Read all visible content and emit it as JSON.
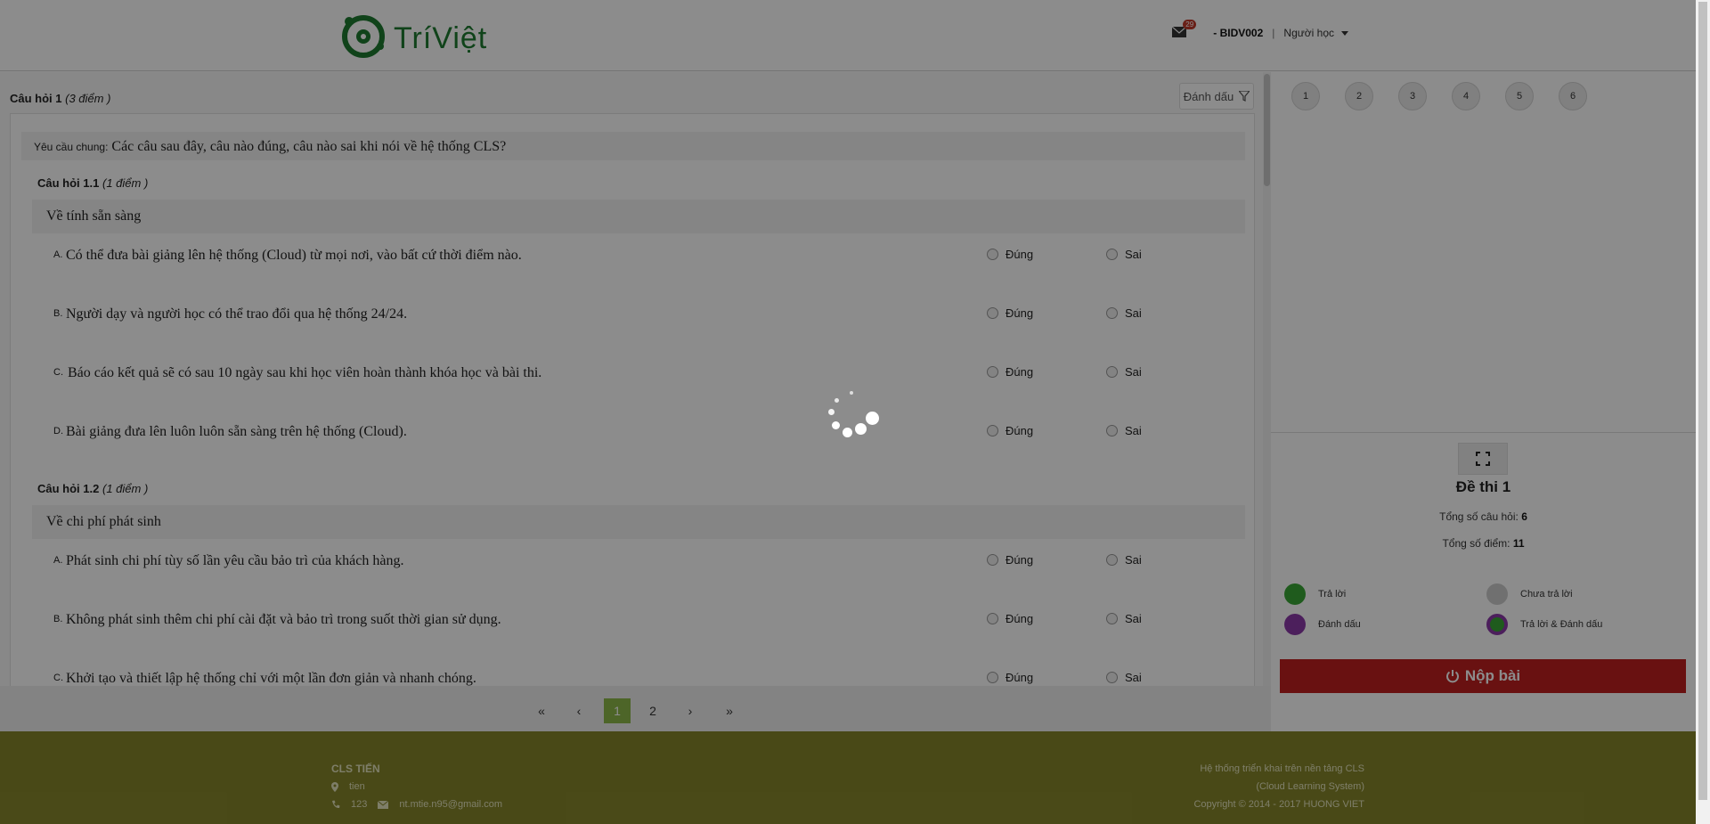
{
  "header": {
    "logo_text": "TríViệt",
    "mail_count": "29",
    "user_code": "- BIDV002",
    "separator": "|",
    "role": "Người học"
  },
  "question": {
    "title": "Câu hỏi 1",
    "points": "(3 điểm )",
    "mark_label": "Đánh dấu",
    "requirement_label": "Yêu cầu chung:",
    "requirement_text": "Các câu sau đây, câu nào đúng, câu nào sai khi nói về hệ thống CLS?",
    "true_label": "Đúng",
    "false_label": "Sai",
    "subquestions": [
      {
        "title": "Câu hỏi 1.1",
        "points": "(1 điểm )",
        "topic": "Về tính sẵn sàng",
        "answers": [
          {
            "letter": "A.",
            "text": "Có thể đưa bài giảng  lên hệ thống (Cloud) từ mọi nơi, vào bất cứ thời điểm nào."
          },
          {
            "letter": "B.",
            "text": "Người dạy và người học có thể trao đổi qua hệ thống 24/24."
          },
          {
            "letter": "C.",
            "text": " Báo cáo kết quả sẽ có sau 10 ngày sau khi học viên hoàn thành khóa học và bài thi."
          },
          {
            "letter": "D.",
            "text": "Bài giảng đưa lên luôn luôn sẵn sàng trên hệ thống (Cloud)."
          }
        ]
      },
      {
        "title": "Câu hỏi 1.2",
        "points": "(1 điểm )",
        "topic": "Về chi phí phát sinh",
        "answers": [
          {
            "letter": "A.",
            "text": "Phát sinh chi phí tùy số lần yêu cầu bảo trì của khách hàng."
          },
          {
            "letter": "B.",
            "text": "Không phát sinh thêm chi phí cài đặt và bảo trì trong suốt thời gian sử dụng."
          },
          {
            "letter": "C.",
            "text": "Khởi tạo và thiết lập hệ thống chỉ với một lần đơn giản và nhanh chóng."
          }
        ]
      }
    ]
  },
  "pagination": {
    "first": "«",
    "prev": "‹",
    "pages": [
      "1",
      "2"
    ],
    "current": "1",
    "next": "›",
    "last": "»"
  },
  "sidebar": {
    "question_numbers": [
      "1",
      "2",
      "3",
      "4",
      "5",
      "6"
    ],
    "exam_title": "Đề thi 1",
    "total_questions_label": "Tổng số câu hỏi:",
    "total_questions": "6",
    "total_points_label": "Tổng số điểm:",
    "total_points": "11",
    "legend": {
      "answered": "Trả lời",
      "unanswered": "Chưa trả lời",
      "marked": "Đánh dấu",
      "answered_marked": "Trả lời & Đánh dấu"
    },
    "submit_label": "Nộp bài"
  },
  "footer": {
    "org_name": "CLS TIẾN",
    "location": "tien",
    "phone": "123",
    "email": "nt.mtie.n95@gmail.com",
    "desc_line1": "Hệ thống triển khai trên nền tảng CLS",
    "desc_line2": "(Cloud Learning System)",
    "copyright": "Copyright © 2014 - 2017 HUONG VIET"
  },
  "colors": {
    "brand_green": "#1e7b31",
    "active_page": "#8cb84a",
    "answered": "#3aa635",
    "unanswered": "#cccccc",
    "marked": "#8b3aa8",
    "submit": "#c0201f",
    "footer": "#86862b"
  },
  "icons": [
    "mail-icon",
    "caret-down-icon",
    "filter-icon",
    "fullscreen-icon",
    "power-icon",
    "map-marker-icon",
    "phone-icon",
    "envelope-icon",
    "loading-spinner-icon"
  ]
}
